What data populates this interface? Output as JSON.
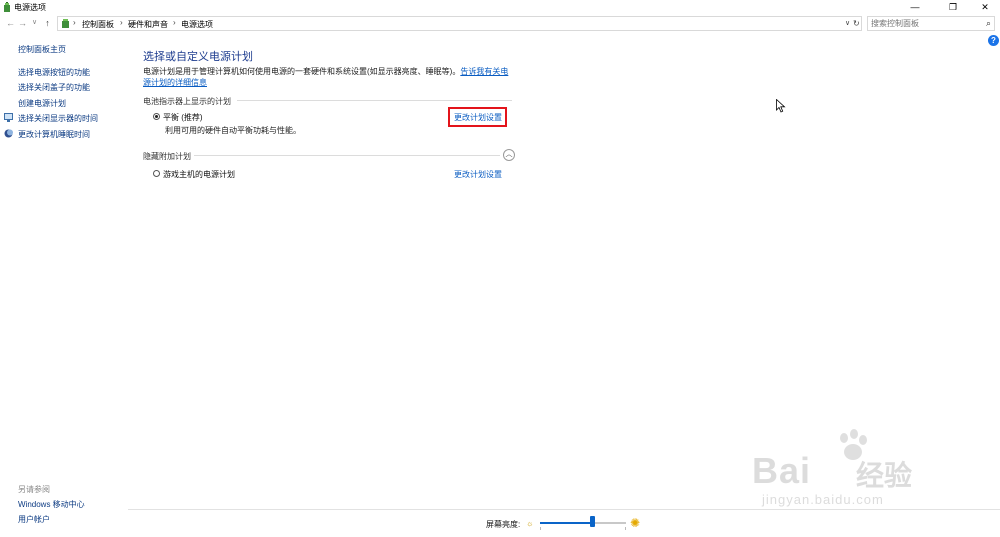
{
  "window": {
    "title": "电源选项",
    "controls": {
      "minimize": "—",
      "maximize": "❐",
      "close": "✕"
    }
  },
  "address_bar": {
    "nav": {
      "back": "←",
      "forward": "→",
      "recent": "∨",
      "up": "↑"
    },
    "breadcrumbs": [
      "控制面板",
      "硬件和声音",
      "电源选项"
    ],
    "separator": "›",
    "dropdown": "∨",
    "refresh": "↻"
  },
  "search": {
    "placeholder": "搜索控制面板",
    "icon": "⌕"
  },
  "sidebar": {
    "home": "控制面板主页",
    "items": [
      {
        "label": "选择电源按钮的功能",
        "icon": null
      },
      {
        "label": "选择关闭盖子的功能",
        "icon": null
      },
      {
        "label": "创建电源计划",
        "icon": null
      },
      {
        "label": "选择关闭显示器的时间",
        "icon": "display-icon"
      },
      {
        "label": "更改计算机睡眠时间",
        "icon": "moon-icon"
      }
    ],
    "see_also_title": "另请参阅",
    "see_also": [
      "Windows 移动中心",
      "用户帐户"
    ]
  },
  "main": {
    "title": "选择或自定义电源计划",
    "description": "电源计划是用于管理计算机如何使用电源的一套硬件和系统设置(如显示器亮度、睡眠等)。",
    "description_link": "告诉我有关电源计划的详细信息",
    "group_shown": "电池指示器上显示的计划",
    "plan_balanced": {
      "name": "平衡 (推荐)",
      "description": "利用可用的硬件自动平衡功耗与性能。",
      "link": "更改计划设置",
      "selected": true
    },
    "group_hidden": "隐藏附加计划",
    "expander_icon": "︿",
    "plan_game": {
      "name": "游戏主机的电源计划",
      "link": "更改计划设置",
      "selected": false
    },
    "help": "?"
  },
  "bottom_bar": {
    "brightness_label": "屏幕亮度:",
    "brightness_level_percent": 60,
    "dim_icon": "☼",
    "bright_icon": "✺"
  },
  "watermark": {
    "brand": "Bai",
    "brand2": "经验",
    "url": "jingyan.baidu.com"
  },
  "colors": {
    "link": "#0a5cc2",
    "nav_link": "#0b3a82",
    "title": "#1e3d8f",
    "highlight": "#e3141b",
    "accent": "#0a64c8"
  }
}
